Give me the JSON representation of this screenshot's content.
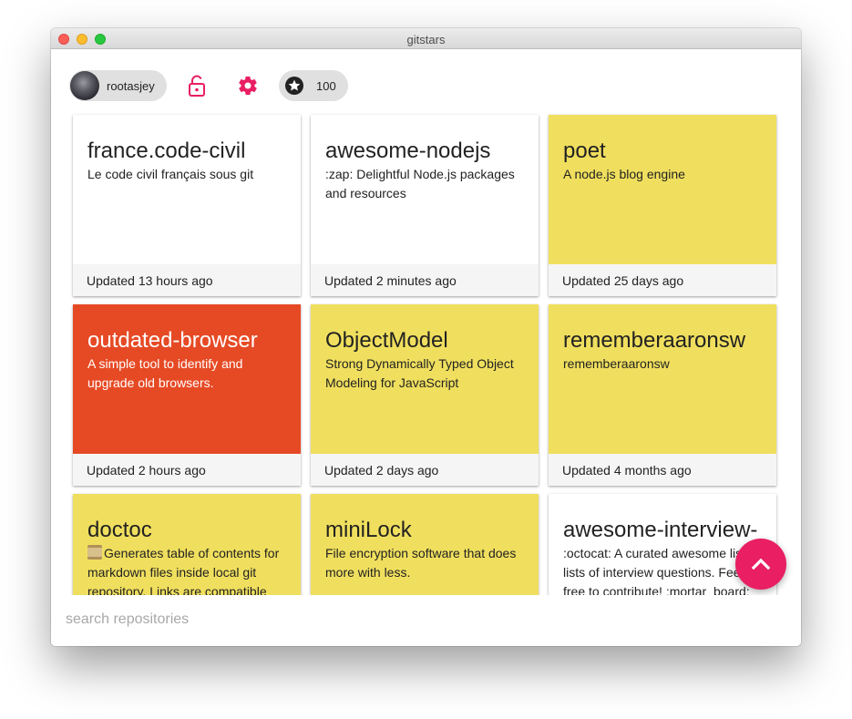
{
  "window": {
    "title": "gitstars"
  },
  "toolbar": {
    "username": "rootasjey",
    "star_count": "100",
    "lock_icon": "lock-open-icon",
    "settings_icon": "gear-icon",
    "star_icon": "star-icon",
    "accent_color": "#e91e63"
  },
  "repos": [
    {
      "name": "france.code-civil",
      "description": "Le code civil français sous git",
      "updated": "Updated 13 hours ago",
      "color": "white"
    },
    {
      "name": "awesome-nodejs",
      "description": ":zap: Delightful Node.js packages and resources",
      "updated": "Updated 2 minutes ago",
      "color": "white"
    },
    {
      "name": "poet",
      "description": "A node.js blog engine",
      "updated": "Updated 25 days ago",
      "color": "yellow"
    },
    {
      "name": "outdated-browser",
      "description": "A simple tool to identify and upgrade old browsers.",
      "updated": "Updated 2 hours ago",
      "color": "red"
    },
    {
      "name": "ObjectModel",
      "description": "Strong Dynamically Typed Object Modeling for JavaScript",
      "updated": "Updated 2 days ago",
      "color": "yellow"
    },
    {
      "name": "rememberaaronsw",
      "description": "rememberaaronsw",
      "updated": "Updated 4 months ago",
      "color": "yellow"
    },
    {
      "name": "doctoc",
      "description": "Generates table of contents for markdown files inside local git repository. Links are compatible",
      "updated": "",
      "color": "yellow"
    },
    {
      "name": "miniLock",
      "description": "File encryption software that does more with less.",
      "updated": "",
      "color": "yellow"
    },
    {
      "name": "awesome-interview-",
      "description": ":octocat: A curated awesome list of lists of interview questions. Feel free to contribute! :mortar_board:",
      "updated": "",
      "color": "white"
    }
  ],
  "colors": {
    "white": "#ffffff",
    "yellow": "#f0df5e",
    "red": "#e64a25"
  },
  "search": {
    "placeholder": "search repositories",
    "value": ""
  },
  "fab": {
    "icon": "chevron-up-icon"
  }
}
